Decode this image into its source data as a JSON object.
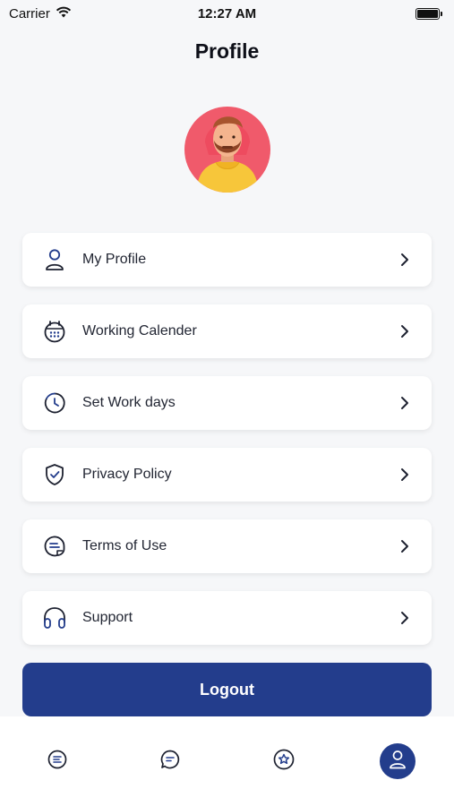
{
  "status_bar": {
    "carrier": "Carrier",
    "time": "12:27 AM",
    "icons": [
      "wifi-icon",
      "battery-icon"
    ]
  },
  "header": {
    "title": "Profile"
  },
  "menu": {
    "items": [
      {
        "label": "My Profile",
        "icon": "user-icon"
      },
      {
        "label": "Working Calender",
        "icon": "calendar-icon"
      },
      {
        "label": "Set Work days",
        "icon": "clock-icon"
      },
      {
        "label": "Privacy Policy",
        "icon": "shield-check-icon"
      },
      {
        "label": "Terms of Use",
        "icon": "document-icon"
      },
      {
        "label": "Support",
        "icon": "headphones-icon"
      }
    ]
  },
  "logout": {
    "label": "Logout"
  },
  "tab_bar": {
    "tabs": [
      {
        "icon": "list-icon",
        "active": false
      },
      {
        "icon": "chat-icon",
        "active": false
      },
      {
        "icon": "badge-icon",
        "active": false
      },
      {
        "icon": "user-icon",
        "active": true
      }
    ]
  },
  "colors": {
    "primary": "#233d8c",
    "background": "#f6f7f9",
    "card": "#ffffff",
    "text": "#222633"
  }
}
